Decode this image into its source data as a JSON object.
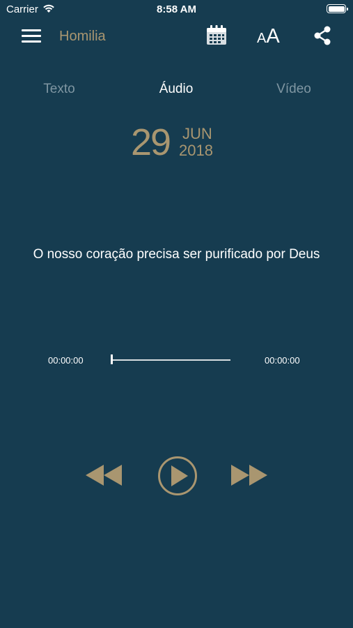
{
  "status_bar": {
    "carrier": "Carrier",
    "time": "8:58 AM"
  },
  "nav": {
    "title": "Homilia",
    "font_small": "A",
    "font_big": "A"
  },
  "tabs": [
    {
      "label": "Texto",
      "active": false
    },
    {
      "label": "Áudio",
      "active": true
    },
    {
      "label": "Vídeo",
      "active": false
    }
  ],
  "date": {
    "day": "29",
    "month": "JUN",
    "year": "2018"
  },
  "homily": {
    "title": "O nosso coração precisa ser purificado por Deus"
  },
  "player": {
    "current_time": "00:00:00",
    "total_time": "00:00:00",
    "progress": 0
  },
  "colors": {
    "background": "#163c50",
    "accent_gold": "#a99670",
    "inactive_tab": "#7f96a2"
  },
  "icons": {
    "menu": "hamburger-menu-icon",
    "calendar": "calendar-icon",
    "font_size": "font-size-icon",
    "share": "share-icon",
    "rewind": "rewind-icon",
    "play": "play-icon",
    "forward": "fast-forward-icon"
  }
}
